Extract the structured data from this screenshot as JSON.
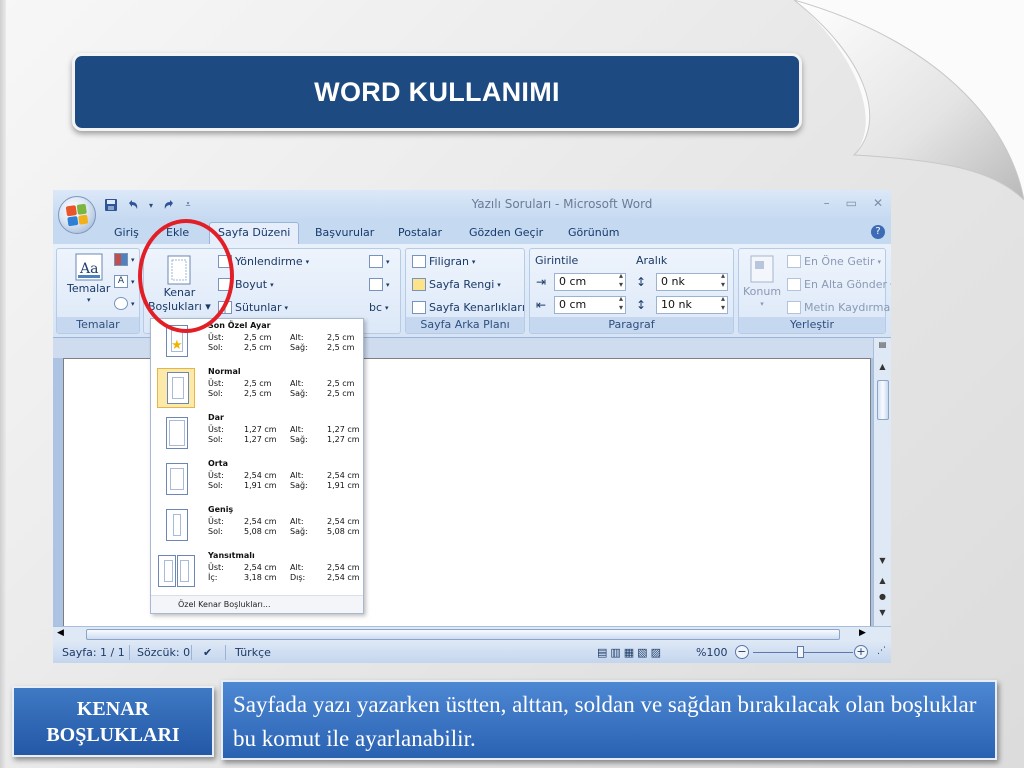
{
  "slide": {
    "title": "WORD KULLANIMI",
    "label_box": "KENAR\nBOŞLUKLARI",
    "description": "Sayfada yazı yazarken  üstten, alttan, soldan ve sağdan bırakılacak olan boşluklar bu komut ile ayarlanabilir."
  },
  "window": {
    "title": "Yazılı Soruları - Microsoft Word",
    "controls": [
      "–",
      "▭",
      "✕"
    ]
  },
  "tabs": [
    "Giriş",
    "Ekle",
    "Sayfa Düzeni",
    "Başvurular",
    "Postalar",
    "Gözden Geçir",
    "Görünüm"
  ],
  "active_tab": "Sayfa Düzeni",
  "ribbon": {
    "themes": {
      "button": "Temalar",
      "group": "Temalar"
    },
    "page_setup": {
      "margins_line1": "Kenar",
      "margins_line2": "Boşlukları",
      "orientation": "Yönlendirme",
      "size": "Boyut",
      "columns": "Sütunlar"
    },
    "page_background": {
      "watermark": "Filigran",
      "page_color": "Sayfa Rengi",
      "page_borders": "Sayfa Kenarlıkları",
      "group": "Sayfa Arka Planı"
    },
    "paragraph": {
      "indent": "Girintile",
      "spacing": "Aralık",
      "indent_left": "0 cm",
      "indent_right": "0 cm",
      "spacing_before": "0 nk",
      "spacing_after": "10 nk",
      "group": "Paragraf"
    },
    "arrange": {
      "position": "Konum",
      "bring_front": "En Öne Getir",
      "send_back": "En Alta Gönder",
      "text_wrap": "Metin Kaydırma",
      "group": "Yerleştir"
    }
  },
  "margins_menu": {
    "items": [
      {
        "name": "Son Özel Ayar",
        "top_label": "Üst:",
        "top": "2,5 cm",
        "bottom_label": "Alt:",
        "bottom": "2,5 cm",
        "left_label": "Sol:",
        "left": "2,5 cm",
        "right_label": "Sağ:",
        "right": "2,5 cm"
      },
      {
        "name": "Normal",
        "top_label": "Üst:",
        "top": "2,5 cm",
        "bottom_label": "Alt:",
        "bottom": "2,5 cm",
        "left_label": "Sol:",
        "left": "2,5 cm",
        "right_label": "Sağ:",
        "right": "2,5 cm"
      },
      {
        "name": "Dar",
        "top_label": "Üst:",
        "top": "1,27 cm",
        "bottom_label": "Alt:",
        "bottom": "1,27 cm",
        "left_label": "Sol:",
        "left": "1,27 cm",
        "right_label": "Sağ:",
        "right": "1,27 cm"
      },
      {
        "name": "Orta",
        "top_label": "Üst:",
        "top": "2,54 cm",
        "bottom_label": "Alt:",
        "bottom": "2,54 cm",
        "left_label": "Sol:",
        "left": "1,91 cm",
        "right_label": "Sağ:",
        "right": "1,91 cm"
      },
      {
        "name": "Geniş",
        "top_label": "Üst:",
        "top": "2,54 cm",
        "bottom_label": "Alt:",
        "bottom": "2,54 cm",
        "left_label": "Sol:",
        "left": "5,08 cm",
        "right_label": "Sağ:",
        "right": "5,08 cm"
      },
      {
        "name": "Yansıtmalı",
        "top_label": "Üst:",
        "top": "2,54 cm",
        "bottom_label": "Alt:",
        "bottom": "2,54 cm",
        "left_label": "İç:",
        "left": "3,18 cm",
        "right_label": "Dış:",
        "right": "2,54 cm"
      }
    ],
    "footer": "Özel Kenar Boşlukları..."
  },
  "status": {
    "page": "Sayfa: 1 / 1",
    "words": "Sözcük: 0",
    "language": "Türkçe",
    "zoom": "%100"
  },
  "colors": {
    "title_bg": "#1d4a80",
    "highlight_circle": "#e21e26",
    "selected_item": "#fde9a8",
    "box_blue": "#2a62b2"
  }
}
